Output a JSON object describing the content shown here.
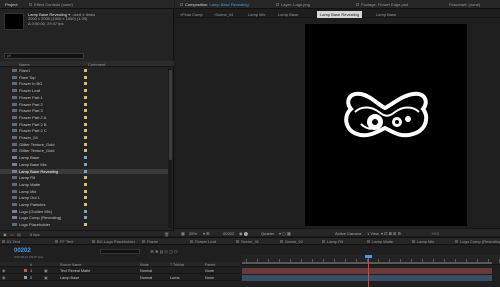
{
  "project": {
    "tabs": [
      {
        "label": "Project"
      },
      {
        "label": "Effect Controls (none)"
      }
    ],
    "item_name": "Lamp Base Revealing",
    "item_used": "▾, used 4 times",
    "item_details": [
      "2000 x 2000 (1000 x 1000) (1.00)",
      "Δ 0:00:00, 29.97 fps"
    ],
    "search_placeholder": "ρ▾",
    "col_name": "Name",
    "col_comment": "Comment",
    "items": [
      {
        "name": "Flare1",
        "color": "#d0c070"
      },
      {
        "name": "Flare Top",
        "color": "#d0c070"
      },
      {
        "name": "Flower In BG",
        "color": "#d0c070"
      },
      {
        "name": "Flower Leaf",
        "color": "#d0c070"
      },
      {
        "name": "Flower Part 1",
        "color": "#d0c070"
      },
      {
        "name": "Flower Part 2",
        "color": "#d0c070"
      },
      {
        "name": "Flower Part 3",
        "color": "#d0c070"
      },
      {
        "name": "Flower Part 2 A",
        "color": "#d0c070"
      },
      {
        "name": "Flower Part 2 B",
        "color": "#d0c070"
      },
      {
        "name": "Flower Part 2 C",
        "color": "#d0c070"
      },
      {
        "name": "Flower_04",
        "color": "#d0c070"
      },
      {
        "name": "Glitter Texture_Gold",
        "color": "#d0c070"
      },
      {
        "name": "Glitter Texture_Gold",
        "color": "#d0c070"
      },
      {
        "name": "Lamp Base",
        "color": "#7fa0c8"
      },
      {
        "name": "Lamp Base Mix",
        "color": "#7fa0c8"
      },
      {
        "name": "Lamp Base Revealing",
        "color": "#7fa0c8",
        "selected": true
      },
      {
        "name": "Lamp Fill",
        "color": "#d0c070"
      },
      {
        "name": "Lamp Matte",
        "color": "#d0c070"
      },
      {
        "name": "Lamp Mix",
        "color": "#d0c070"
      },
      {
        "name": "Lamp Out 1",
        "color": "#d0c070"
      },
      {
        "name": "Lamp Particles",
        "color": "#d0c070"
      },
      {
        "name": "Logo (Golden Mix)",
        "color": "#7fa0c8"
      },
      {
        "name": "Logo Comp (Revealing)",
        "color": "#7fa0c8"
      },
      {
        "name": "Logo Placeholder",
        "color": "#d0c070"
      }
    ],
    "bpc": "8 bpc"
  },
  "composition": {
    "tabs": [
      {
        "label": "Composition",
        "value": "Lamp Base Revealing",
        "active": true
      },
      {
        "label": "Layer: Logo.png"
      },
      {
        "label": "Footage: Flower Edge.psd"
      },
      {
        "label": "Flowchart: (none)"
      }
    ],
    "breadcrumbs": [
      {
        "label": "«Final Comp"
      },
      {
        "label": "‹Scene_04"
      },
      {
        "label": "Lamp Mix"
      },
      {
        "label": "Lamp Base"
      },
      {
        "label": "Lamp Base Revealing",
        "active": true
      },
      {
        "label": "Lamp Base"
      }
    ],
    "bottombar": {
      "zoom": "25%",
      "timecode": "00202",
      "resolution": "Quarter",
      "camera": "Active Camera",
      "view": "1 View",
      "exposure": "+0.0"
    }
  },
  "timeline": {
    "tabs": [
      {
        "label": "01 Text"
      },
      {
        "label": "FF Text"
      },
      {
        "label": "BG Logo Placeholder"
      },
      {
        "label": "Flame"
      },
      {
        "label": "Flower Leaf"
      },
      {
        "label": "Scene_01"
      },
      {
        "label": "Scene_02"
      },
      {
        "label": "Lamp Fill"
      },
      {
        "label": "Lamp Matte"
      },
      {
        "label": "Lamp Mix"
      },
      {
        "label": "Logo Comp (Revealing)"
      }
    ],
    "timecode": "00202",
    "frame_info": "0:00:06:22 (29.97 fps)",
    "columns": {
      "num": "#",
      "source_name": "Source Name",
      "mode": "Mode",
      "trkmat": "T TrkMat",
      "parent": "Parent"
    },
    "layers": [
      {
        "num": "1",
        "name": "Text Reveal Matte",
        "mode": "Normal",
        "parent": "None",
        "color": "#c05c5c"
      },
      {
        "num": "2",
        "name": "Lamp Base",
        "mode": "Normal",
        "trkmat": "Luma",
        "parent": "None",
        "color": "#7fa0c8"
      }
    ]
  },
  "colors": {
    "accent": "#3f9fe8",
    "playhead": "#e83a3a"
  }
}
